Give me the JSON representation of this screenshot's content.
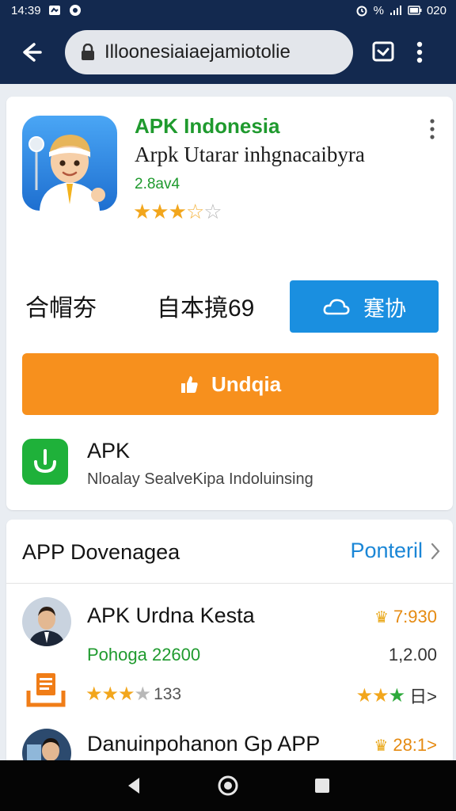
{
  "status": {
    "time": "14:39",
    "battery": "020",
    "signal": "%"
  },
  "browser": {
    "url": "Illoonesiaiaejamiotolie"
  },
  "app": {
    "name": "APK Indonesia",
    "subtitle": "Arpk Utarar inhgnacaibyra",
    "version": "2.8av4",
    "rating_stars": "★★★☆☆"
  },
  "stats": {
    "stat1": "合帽夯",
    "stat2": "自本摬69"
  },
  "buttons": {
    "install_label": "蹇协",
    "download_label": "Undqia"
  },
  "apk": {
    "title": "APK",
    "desc": "Nloalay SealveKipa Indoluinsing"
  },
  "section": {
    "title": "APP Dovenagea",
    "more_label": "Ponteril"
  },
  "rows": [
    {
      "title": "APK Urdna Kesta",
      "sub": "Pohoga 22600",
      "right_top": "7:930",
      "right_mid": "1,2.00",
      "stars_count": "133",
      "right_bottom": "日>"
    },
    {
      "title": "Danuinpohanon Gp APP",
      "right_top": "28:1>"
    }
  ],
  "colors": {
    "header": "#13294f",
    "green": "#1f9a2e",
    "blue": "#1a8fe0",
    "orange": "#f7901d",
    "link": "#1a86d6"
  }
}
